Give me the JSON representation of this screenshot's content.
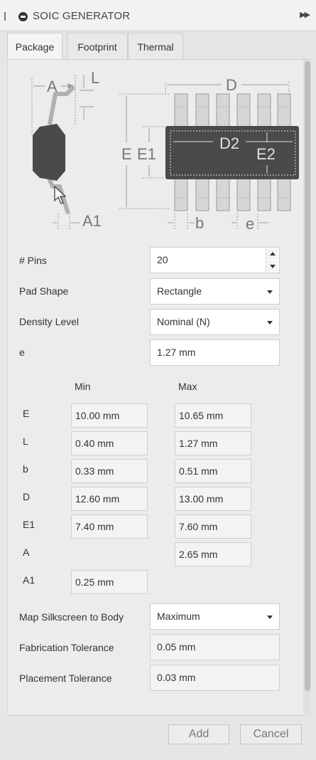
{
  "window": {
    "title": "SOIC GENERATOR"
  },
  "tabs": [
    {
      "label": "Package"
    },
    {
      "label": "Footprint"
    },
    {
      "label": "Thermal"
    }
  ],
  "diagram": {
    "labels": {
      "A": "A",
      "L": "L",
      "A1": "A1",
      "D": "D",
      "E": "E",
      "E1": "E1",
      "D2": "D2",
      "E2": "E2",
      "b": "b",
      "e": "e"
    }
  },
  "form": {
    "pins": {
      "label": "# Pins",
      "value": "20"
    },
    "pad_shape": {
      "label": "Pad Shape",
      "value": "Rectangle"
    },
    "density": {
      "label": "Density Level",
      "value": "Nominal (N)"
    },
    "pitch": {
      "label": "e",
      "value": "1.27 mm"
    }
  },
  "dims": {
    "min_header": "Min",
    "max_header": "Max",
    "rows": [
      {
        "label": "E",
        "min": "10.00 mm",
        "max": "10.65 mm"
      },
      {
        "label": "L",
        "min": "0.40 mm",
        "max": "1.27 mm"
      },
      {
        "label": "b",
        "min": "0.33 mm",
        "max": "0.51 mm"
      },
      {
        "label": "D",
        "min": "12.60 mm",
        "max": "13.00 mm"
      },
      {
        "label": "E1",
        "min": "7.40 mm",
        "max": "7.60 mm"
      },
      {
        "label": "A",
        "min": null,
        "max": "2.65 mm"
      },
      {
        "label": "A1",
        "min": "0.25 mm",
        "max": null
      }
    ]
  },
  "bottom": {
    "silkscreen": {
      "label": "Map Silkscreen to Body",
      "value": "Maximum"
    },
    "fab_tol": {
      "label": "Fabrication Tolerance",
      "value": "0.05 mm"
    },
    "place_tol": {
      "label": "Placement Tolerance",
      "value": "0.03 mm"
    }
  },
  "buttons": {
    "add": "Add",
    "cancel": "Cancel"
  }
}
